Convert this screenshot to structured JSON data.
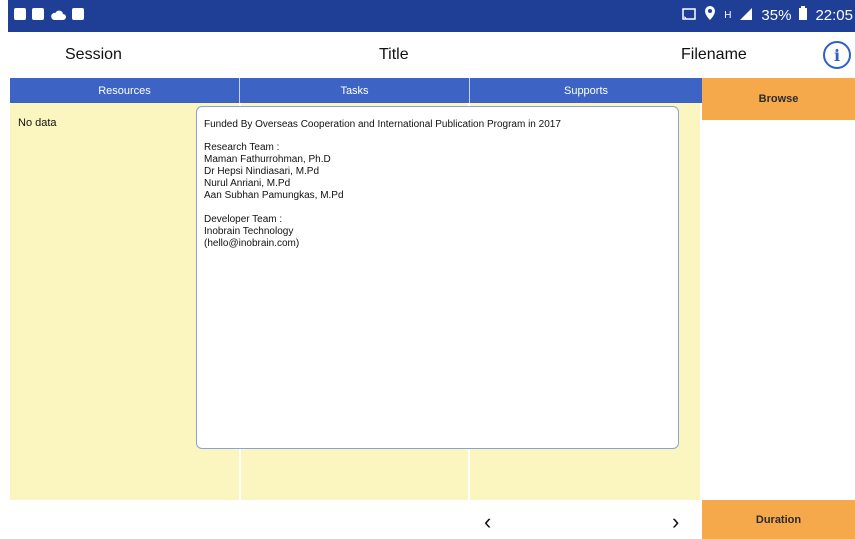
{
  "status": {
    "battery": "35%",
    "time": "22:05",
    "left_icons": [
      "gallery-icon",
      "camera-icon",
      "cloud-icon",
      "photo-icon"
    ],
    "right_icons": [
      "cast-icon",
      "location-icon",
      "hplus-icon",
      "signal-icon",
      "battery-icon"
    ]
  },
  "header": {
    "session": "Session",
    "title": "Title",
    "filename": "Filename",
    "info_icon": "i"
  },
  "tabs": {
    "resources": "Resources",
    "tasks": "Tasks",
    "supports": "Supports"
  },
  "buttons": {
    "browse": "Browse",
    "duration": "Duration"
  },
  "resources": {
    "empty": "No data"
  },
  "dialog": {
    "lines": [
      "Funded By Overseas Cooperation and International Publication Program in 2017",
      "Research Team :",
      "Maman Fathurrohman, Ph.D",
      "Dr Hepsi Nindiasari, M.Pd",
      "Nurul Anriani, M.Pd",
      "Aan Subhan Pamungkas, M.Pd",
      "Developer Team :",
      "Inobrain Technology",
      "(hello@inobrain.com)"
    ]
  },
  "nav": {
    "prev": "‹",
    "next": "›"
  },
  "colors": {
    "statusbar": "#1f3f96",
    "tab": "#3d63c4",
    "accent_orange": "#f6a94a",
    "panel_yellow": "#fbf6bf",
    "info_blue": "#2d5fd0"
  }
}
